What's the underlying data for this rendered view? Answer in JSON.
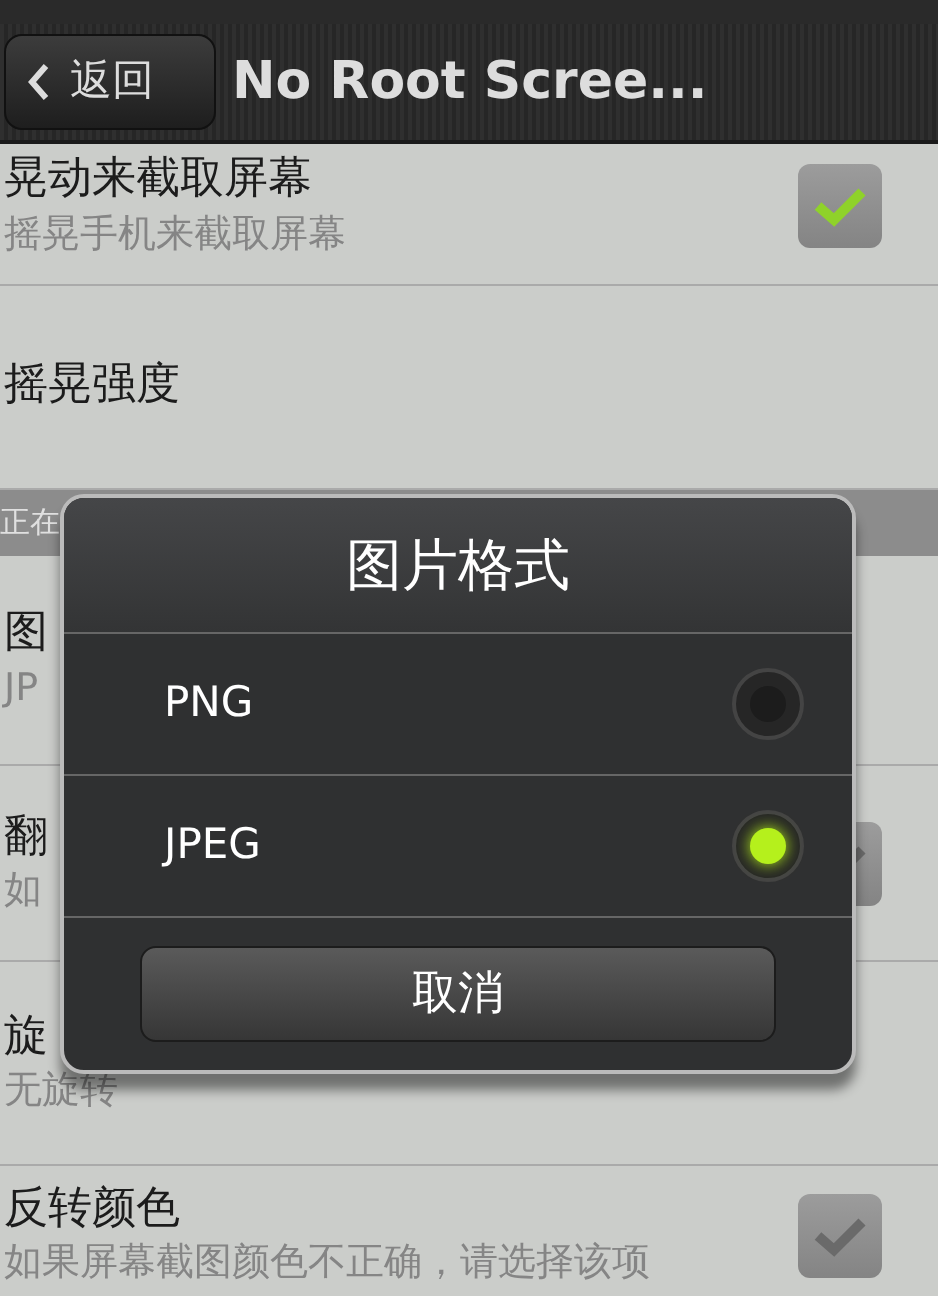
{
  "action_bar": {
    "back_button": "返回",
    "title": "No Root Scree..."
  },
  "settings": [
    {
      "kind": "check",
      "title": "晃动来截取屏幕",
      "summary": "摇晃手机来截取屏幕",
      "checked": true
    },
    {
      "kind": "plain",
      "title": "摇晃强度"
    },
    {
      "kind": "header",
      "title": "正在"
    },
    {
      "kind": "plain",
      "title": "图",
      "summary": "JP"
    },
    {
      "kind": "check",
      "title": "翻",
      "summary": "如",
      "checked": false
    },
    {
      "kind": "plain",
      "title": "旋",
      "summary": "无旋转"
    },
    {
      "kind": "check",
      "title": "反转颜色",
      "summary": "如果屏幕截图颜色不正确，请选择该项",
      "checked": false
    }
  ],
  "dialog": {
    "title": "图片格式",
    "options": [
      {
        "label": "PNG",
        "selected": false
      },
      {
        "label": "JPEG",
        "selected": true
      }
    ],
    "cancel_button": "取消"
  }
}
